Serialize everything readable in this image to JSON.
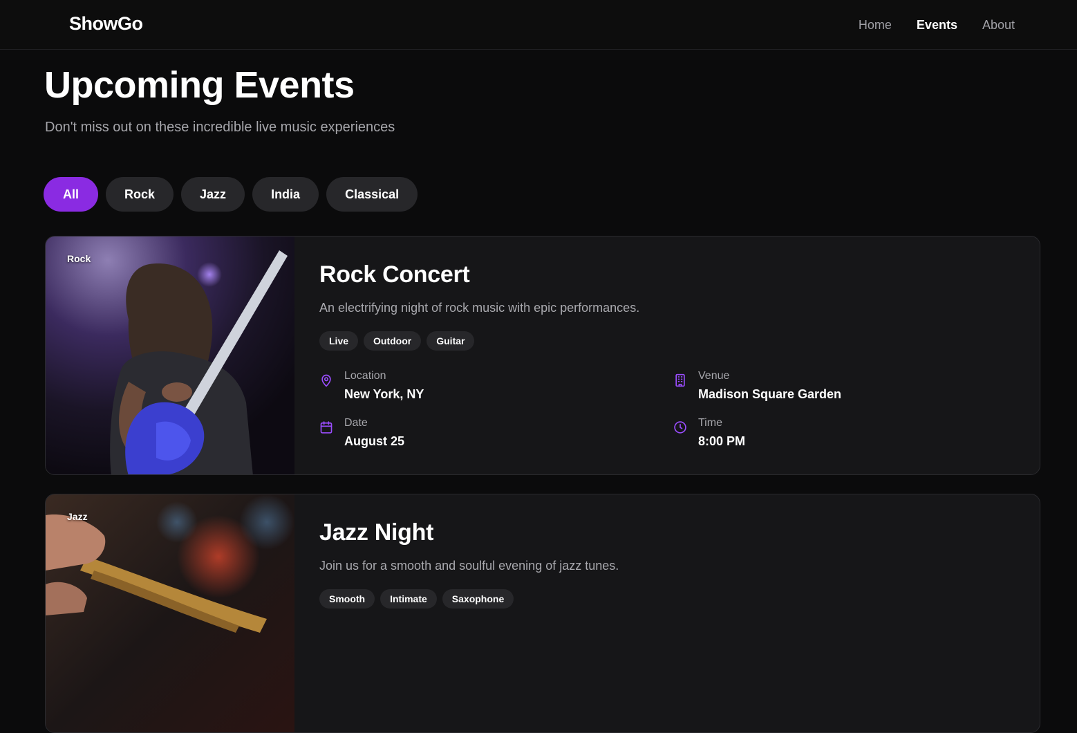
{
  "app": {
    "brand": "ShowGo"
  },
  "nav": {
    "items": [
      {
        "label": "Home"
      },
      {
        "label": "Events"
      },
      {
        "label": "About"
      }
    ],
    "active": "Events"
  },
  "header": {
    "title": "Upcoming Events",
    "subtitle": "Don't miss out on these incredible live music experiences"
  },
  "filters": [
    {
      "label": "All"
    },
    {
      "label": "Rock"
    },
    {
      "label": "Jazz"
    },
    {
      "label": "India"
    },
    {
      "label": "Classical"
    }
  ],
  "active_filter": "All",
  "accent_color": "#8a2be2",
  "events": [
    {
      "genre": "Rock",
      "title": "Rock Concert",
      "description": "An electrifying night of rock music with epic performances.",
      "tags": [
        "Live",
        "Outdoor",
        "Guitar"
      ],
      "location_label": "Location",
      "location": "New York, NY",
      "venue_label": "Venue",
      "venue": "Madison Square Garden",
      "date_label": "Date",
      "date": "August 25",
      "time_label": "Time",
      "time": "8:00 PM"
    },
    {
      "genre": "Jazz",
      "title": "Jazz Night",
      "description": "Join us for a smooth and soulful evening of jazz tunes.",
      "tags": [
        "Smooth",
        "Intimate",
        "Saxophone"
      ]
    }
  ],
  "icons": {
    "location": "map-pin-icon",
    "venue": "building-icon",
    "date": "calendar-icon",
    "time": "clock-icon"
  }
}
